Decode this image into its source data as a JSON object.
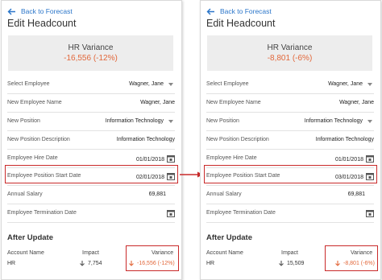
{
  "left": {
    "back_label": "Back to Forecast",
    "title": "Edit Headcount",
    "summary": {
      "title": "HR Variance",
      "value": "-16,556 (-12%)"
    },
    "fields": [
      {
        "label": "Select Employee",
        "value": "Wagner, Jane"
      },
      {
        "label": "New Employee Name",
        "value": "Wagner, Jane"
      },
      {
        "label": "New Position",
        "value": "Information Technology"
      },
      {
        "label": "New Position Description",
        "value": "Information Technology"
      },
      {
        "label": "Employee Hire Date",
        "value": "01/01/2018"
      },
      {
        "label": "Employee Position Start Date",
        "value": "02/01/2018"
      },
      {
        "label": "Annual Salary",
        "value": "69,881"
      },
      {
        "label": "Employee Termination Date",
        "value": ""
      }
    ],
    "after_update": {
      "heading": "After Update",
      "columns": [
        "Account Name",
        "Impact",
        "Variance"
      ],
      "row": {
        "account": "HR",
        "impact": "7,754",
        "variance": "-16,556 (-12%)"
      }
    }
  },
  "right": {
    "back_label": "Back to Forecast",
    "title": "Edit Headcount",
    "summary": {
      "title": "HR Variance",
      "value": "-8,801 (-6%)"
    },
    "fields": [
      {
        "label": "Select Employee",
        "value": "Wagner, Jane"
      },
      {
        "label": "New Employee Name",
        "value": "Wagner, Jane"
      },
      {
        "label": "New Position",
        "value": "Information Technology"
      },
      {
        "label": "New Position Description",
        "value": "Information Technology"
      },
      {
        "label": "Employee Hire Date",
        "value": "01/01/2018"
      },
      {
        "label": "Employee Position Start Date",
        "value": "03/01/2018"
      },
      {
        "label": "Annual Salary",
        "value": "69,881"
      },
      {
        "label": "Employee Termination Date",
        "value": ""
      }
    ],
    "after_update": {
      "heading": "After Update",
      "columns": [
        "Account Name",
        "Impact",
        "Variance"
      ],
      "row": {
        "account": "HR",
        "impact": "15,509",
        "variance": "-8,801 (-6%)"
      }
    }
  },
  "icons": {
    "back": "back-arrow-icon",
    "dropdown": "chevron-down-icon",
    "calendar": "calendar-icon",
    "impact_arrow": "arrow-down-icon",
    "connector": "arrow-right-icon"
  },
  "colors": {
    "accent": "#2a75c9",
    "negative": "#e2673a",
    "highlight": "#c92a2a",
    "summary_bg": "#ededed"
  }
}
